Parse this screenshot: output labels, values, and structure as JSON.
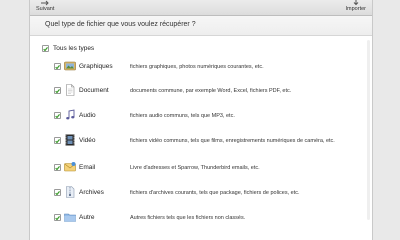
{
  "toolbar": {
    "left_label": "Suivant",
    "left_icon": "arrow-icon",
    "right_label": "Importer",
    "right_icon": "import-icon"
  },
  "header": {
    "question": "Quel type de fichier que vous voulez récupérer ?"
  },
  "all_types": {
    "label": "Tous les types",
    "checked": true
  },
  "types": [
    {
      "label": "Graphiques",
      "description": "fichiers graphiques, photos numériques courantes, etc.",
      "icon": "photo-icon",
      "checked": true
    },
    {
      "label": "Document",
      "description": "documents commune, par exemple Word, Excel, fichiers PDF, etc.",
      "icon": "document-icon",
      "checked": true
    },
    {
      "label": "Audio",
      "description": "fichiers audio communs, tels que MP3, etc.",
      "icon": "music-note-icon",
      "checked": true
    },
    {
      "label": "Vidéo",
      "description": "fichiers vidéo communs, tels que films, enregistrements numériques de caméra, etc.",
      "icon": "film-icon",
      "checked": true
    },
    {
      "label": "Email",
      "description": "Livre d'adresses et Sparrow, Thunderbird emails, etc.",
      "icon": "envelope-icon",
      "checked": true
    },
    {
      "label": "Archives",
      "description": "fichiers d'archives courants, tels que package, fichiers de polices, etc.",
      "icon": "archive-icon",
      "checked": true
    },
    {
      "label": "Autre",
      "description": "Autres fichiers tels que les fichiers non classés.",
      "icon": "folder-icon",
      "checked": true
    }
  ],
  "colors": {
    "check": "#3a9a2a",
    "accent": "#4a90d9"
  }
}
